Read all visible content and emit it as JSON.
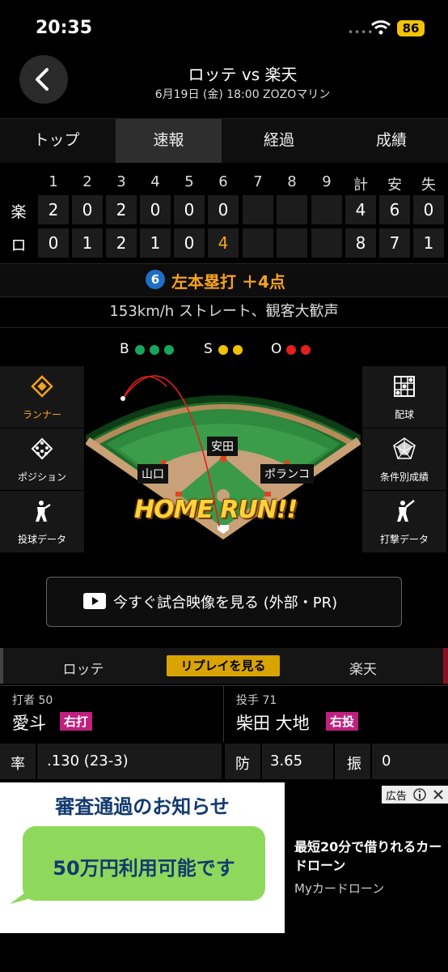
{
  "status_bar": {
    "time": "20:35",
    "battery": "86"
  },
  "header": {
    "title": "ロッテ vs 楽天",
    "subtitle": "6月19日 (金) 18:00 ZOZOマリン"
  },
  "tabs": [
    {
      "label": "トップ",
      "active": false
    },
    {
      "label": "速報",
      "active": true
    },
    {
      "label": "経過",
      "active": false
    },
    {
      "label": "成績",
      "active": false
    }
  ],
  "scoreboard": {
    "innings": [
      "1",
      "2",
      "3",
      "4",
      "5",
      "6",
      "7",
      "8",
      "9"
    ],
    "totals_headers": [
      "計",
      "安",
      "失"
    ],
    "rows": [
      {
        "team": "楽",
        "innings": [
          "2",
          "0",
          "2",
          "0",
          "0",
          "0",
          "",
          "",
          ""
        ],
        "totals": [
          "4",
          "6",
          "0"
        ]
      },
      {
        "team": "ロ",
        "innings": [
          "0",
          "1",
          "2",
          "1",
          "0",
          "4",
          "",
          "",
          ""
        ],
        "totals": [
          "8",
          "7",
          "1"
        ]
      }
    ]
  },
  "play": {
    "inning_badge": "6",
    "result": "左本塁打 ＋4点",
    "pitch": "153km/h ストレート、観客大歓声",
    "count": {
      "B": "B",
      "S": "S",
      "O": "O",
      "balls": 3,
      "strikes": 2,
      "outs": 2
    }
  },
  "colors": {
    "accent": "#f6a21c",
    "ball": "#18a65c",
    "strike": "#f3c000",
    "out": "#e31e1e",
    "hand_badge": "#c0207e"
  },
  "side_left": [
    {
      "label": "ランナー",
      "icon": "diamond-icon",
      "active": true
    },
    {
      "label": "ポジション",
      "icon": "positions-icon",
      "active": false
    },
    {
      "label": "投球データ",
      "icon": "pitcher-icon",
      "active": false
    }
  ],
  "side_right": [
    {
      "label": "配球",
      "icon": "grid-icon",
      "active": false
    },
    {
      "label": "条件別成績",
      "icon": "radar-icon",
      "active": false
    },
    {
      "label": "打撃データ",
      "icon": "batter-icon",
      "active": false
    }
  ],
  "field": {
    "players": [
      "安田",
      "山口",
      "ポランコ"
    ],
    "banner": "HOME RUN!!"
  },
  "video_button": {
    "label": "今すぐ試合映像を見る (外部・PR)"
  },
  "team_bar": {
    "left": "ロッテ",
    "replay": "リプレイを見る",
    "right": "楽天"
  },
  "batter": {
    "label": "打者 50",
    "name": "愛斗",
    "hand": "右打",
    "stat_label": "率",
    "stat_value": ".130 (23-3)"
  },
  "pitcher": {
    "label": "投手 71",
    "name": "柴田 大地",
    "hand": "右投",
    "stat1_label": "防",
    "stat1_value": "3.65",
    "stat2_label": "振",
    "stat2_value": "0"
  },
  "ad": {
    "title": "審査通過のお知らせ",
    "bubble": "50万円利用可能です",
    "headline": "最短20分で借りれるカードローン",
    "source": "Myカードローン",
    "badge": "広告"
  }
}
